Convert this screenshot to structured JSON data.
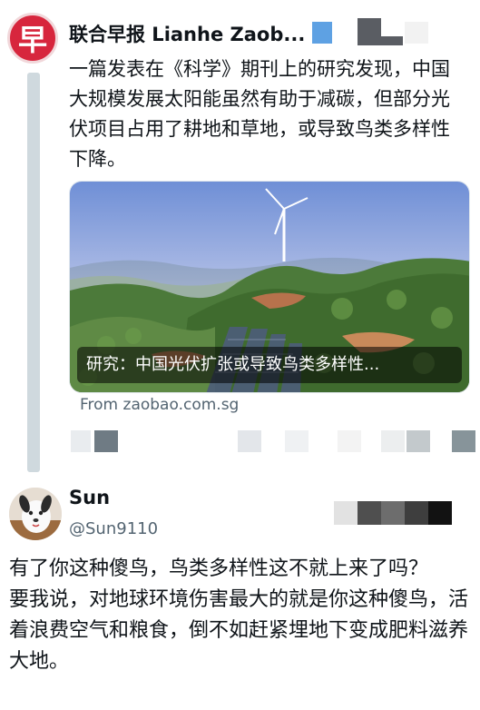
{
  "quoted_tweet": {
    "avatar_char": "早",
    "author_name": "联合早报 Lianhe Zaob...",
    "text": "一篇发表在《科学》期刊上的研究发现，中国大规模发展太阳能虽然有助于减碳，但部分光伏项目占用了耕地和草地，或导致鸟类多样性下降。",
    "card": {
      "caption": "研究：中国光伏扩张或导致鸟类多样性...",
      "source": "From zaobao.com.sg"
    }
  },
  "reply_tweet": {
    "author_name": "Sun",
    "handle": "@Sun9110",
    "text_line1": "有了你这种傻鸟，鸟类多样性这不就上来了吗？",
    "text_line2": "要我说，对地球环境伤害最大的就是你这种傻鸟，活着浪费空气和粮食，倒不如赶紧埋地下变成肥料滋养大地。"
  },
  "colors": {
    "brand_red": "#d7263d",
    "thread_line": "#cfd9de",
    "muted_text": "#536471"
  },
  "icons": [
    "zaobao-logo-avatar",
    "dog-avatar"
  ]
}
